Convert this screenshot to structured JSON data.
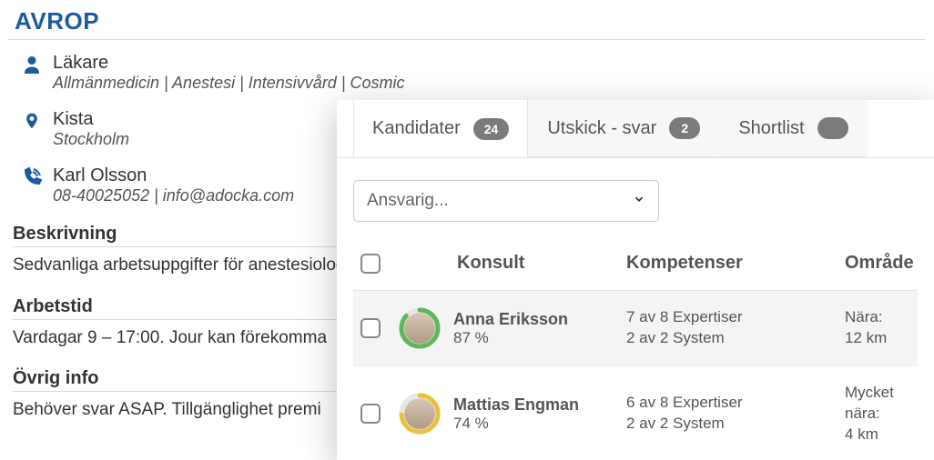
{
  "header": {
    "title": "AVROP"
  },
  "info": {
    "role": "Läkare",
    "specialties": "Allmänmedicin | Anestesi | Intensivvård | Cosmic",
    "city": "Kista",
    "region": "Stockholm",
    "contact_name": "Karl Olsson",
    "contact_sub": "08-40025052 | info@adocka.com"
  },
  "sections": {
    "desc_title": "Beskrivning",
    "desc_body": "Sedvanliga arbetsuppgifter för anestesiolog på operationsavdelning och intensivvårdsav",
    "hours_title": "Arbetstid",
    "hours_body": "Vardagar 9 – 17:00. Jour kan förekomma",
    "other_title": "Övrig info",
    "other_body": "Behöver svar ASAP. Tillgänglighet premi"
  },
  "panel": {
    "tabs": [
      {
        "label": "Kandidater",
        "count": "24"
      },
      {
        "label": "Utskick - svar",
        "count": "2"
      },
      {
        "label": "Shortlist",
        "count": ""
      }
    ],
    "ansvarig_placeholder": "Ansvarig...",
    "columns": {
      "konsult": "Konsult",
      "kompetenser": "Kompetenser",
      "omrade": "Område"
    },
    "rows": [
      {
        "name": "Anna Eriksson",
        "percent": "87 %",
        "ring_color": "#5cb85c",
        "exp": "7 av 8 Expertiser",
        "sys": "2 av 2 System",
        "dist_label": "Nära:",
        "dist": "12 km"
      },
      {
        "name": "Mattias Engman",
        "percent": "74 %",
        "ring_color": "#e8c23b",
        "exp": "6 av 8 Expertiser",
        "sys": "2 av 2 System",
        "dist_label": "Mycket nära:",
        "dist": "4 km"
      }
    ]
  }
}
